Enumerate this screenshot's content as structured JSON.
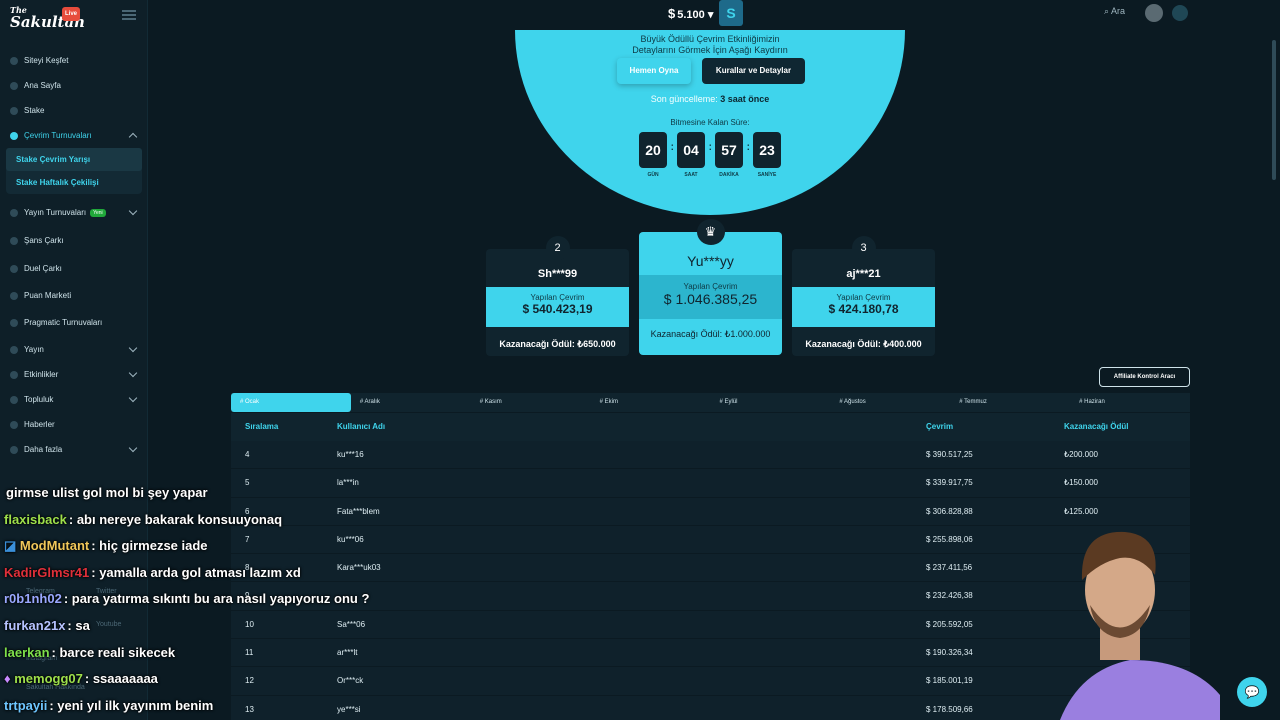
{
  "brand": {
    "small": "The",
    "name": "Sakultah",
    "live": "Live"
  },
  "sidebar": {
    "items": [
      {
        "label": "Siteyi Keşfet",
        "chev": false
      },
      {
        "label": "Ana Sayfa",
        "chev": false
      },
      {
        "label": "Stake",
        "chev": false
      },
      {
        "label": "Çevrim Turnuvaları",
        "chev": true,
        "active": true
      }
    ],
    "sub": [
      "Stake Çevrim Yarışı",
      "Stake Haftalık Çekilişi"
    ],
    "items2": [
      {
        "label": "Yayın Turnuvaları",
        "chev": true,
        "badge": "Yeni"
      },
      {
        "label": "Şans Çarkı",
        "chev": false
      },
      {
        "label": "Duel Çarkı",
        "chev": false
      },
      {
        "label": "Puan Marketi",
        "chev": false
      },
      {
        "label": "Pragmatic Turnuvaları",
        "chev": false
      },
      {
        "label": "Yayın",
        "chev": true
      },
      {
        "label": "Etkinlikler",
        "chev": true
      },
      {
        "label": "Topluluk",
        "chev": true
      },
      {
        "label": "Haberler",
        "chev": false
      },
      {
        "label": "Daha fazla",
        "chev": true
      }
    ],
    "footer": [
      "Telegram",
      "Twitter",
      "Youtube",
      "Instagram",
      "Sakultah Hakkında"
    ]
  },
  "topbar": {
    "currency": "$",
    "balance": "5.100",
    "search": "Ara"
  },
  "hero": {
    "line1": "Büyük Ödüllü Çevrim Etkinliğimizin",
    "line2": "Detaylarını Görmek İçin Aşağı Kaydırın",
    "play": "Hemen Oyna",
    "rules": "Kurallar ve Detaylar",
    "updated_label": "Son güncelleme:",
    "updated_value": "3 saat önce",
    "remain": "Bitmesine Kalan Süre:",
    "timer": [
      {
        "n": "20",
        "l": "GÜN"
      },
      {
        "n": "04",
        "l": "SAAT"
      },
      {
        "n": "57",
        "l": "DAKİKA"
      },
      {
        "n": "23",
        "l": "SANİYE"
      }
    ]
  },
  "podium": {
    "second": {
      "rank": "2",
      "name": "Sh***99",
      "label": "Yapılan Çevrim",
      "value": "$ 540.423,19",
      "prize": "Kazanacağı Ödül: ₺650.000"
    },
    "first": {
      "name": "Yu***yy",
      "label": "Yapılan Çevrim",
      "value": "$ 1.046.385,25",
      "prize": "Kazanacağı Ödül: ₺1.000.000"
    },
    "third": {
      "rank": "3",
      "name": "aj***21",
      "label": "Yapılan Çevrim",
      "value": "$ 424.180,78",
      "prize": "Kazanacağı Ödül: ₺400.000"
    }
  },
  "affiliate": "Affiliate Kontrol Aracı",
  "tabs": [
    "# Ocak",
    "# Aralık",
    "# Kasım",
    "# Ekim",
    "# Eylül",
    "# Ağustos",
    "# Temmuz",
    "# Haziran"
  ],
  "table": {
    "headers": [
      "Sıralama",
      "Kullanıcı Adı",
      "Çevrim",
      "Kazanacağı Ödül"
    ],
    "rows": [
      [
        "4",
        "ku***16",
        "$ 390.517,25",
        "₺200.000"
      ],
      [
        "5",
        "la***in",
        "$ 339.917,75",
        "₺150.000"
      ],
      [
        "6",
        "Fata***blem",
        "$ 306.828,88",
        "₺125.000"
      ],
      [
        "7",
        "ku***06",
        "$ 255.898,06",
        ""
      ],
      [
        "8",
        "Kara***uk03",
        "$ 237.411,56",
        ""
      ],
      [
        "9",
        "",
        "$ 232.426,38",
        ""
      ],
      [
        "10",
        "Sa***06",
        "$ 205.592,05",
        ""
      ],
      [
        "11",
        "ar***lt",
        "$ 190.326,34",
        ""
      ],
      [
        "12",
        "Or***ck",
        "$ 185.001,19",
        ""
      ],
      [
        "13",
        "ye***si",
        "$ 178.509,66",
        ""
      ]
    ]
  },
  "chat": [
    {
      "user": "",
      "color": "#ffffff",
      "text": "girmse ulist gol mol bi şey yapar"
    },
    {
      "user": "flaxisback",
      "color": "#9ee04b",
      "text": ": abı nereye bakarak konsuuyonaq"
    },
    {
      "user": "ModMutant",
      "color": "#f0c75a",
      "text": ": hiç girmezse iade"
    },
    {
      "user": "KadirGlmsr41",
      "color": "#e0303a",
      "text": ": yamalla arda gol atması lazım xd"
    },
    {
      "user": "r0b1nh02",
      "color": "#9aa8ff",
      "text": ": para yatırma sıkıntı bu ara nasıl yapıyoruz onu ?"
    },
    {
      "user": "furkan21x",
      "color": "#b6c3ff",
      "text": ": sa"
    },
    {
      "user": "laerkan",
      "color": "#7ee04b",
      "text": ": barce reali sikecek"
    },
    {
      "user": "memogg07",
      "color": "#9ee04b",
      "text": ": ssaaaaaaa"
    },
    {
      "user": "trtpayii",
      "color": "#6ec6ff",
      "text": ": yeni yıl ilk yayınım benim"
    }
  ]
}
